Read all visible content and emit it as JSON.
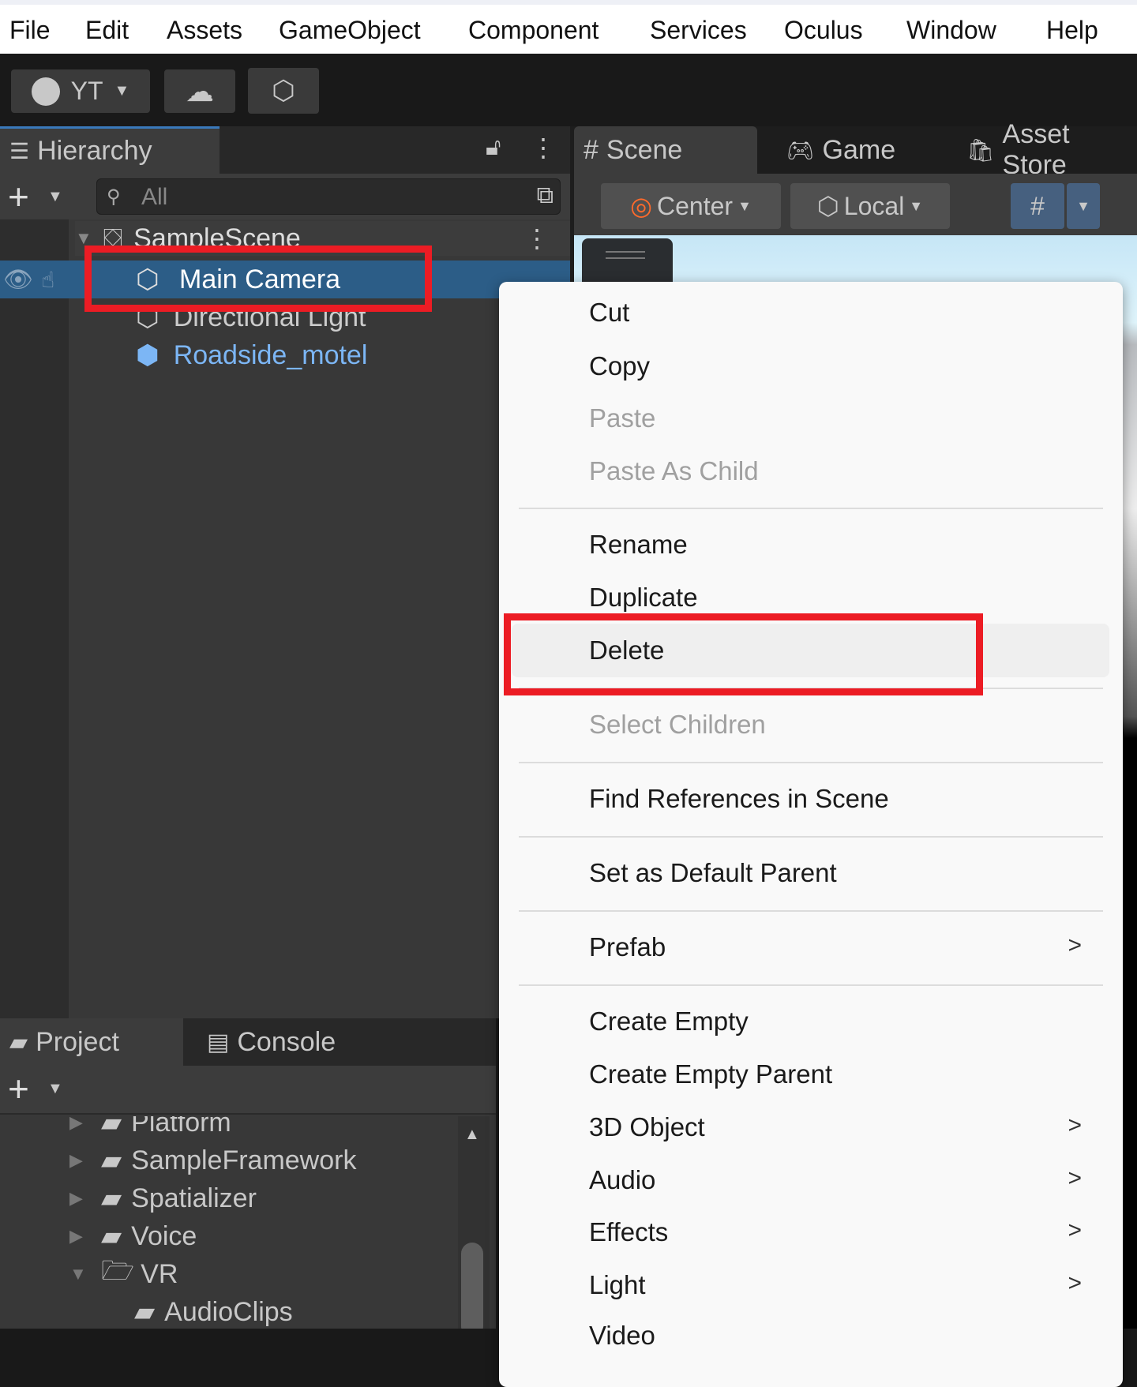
{
  "menubar": [
    "File",
    "Edit",
    "Assets",
    "GameObject",
    "Component",
    "Services",
    "Oculus",
    "Window",
    "Help"
  ],
  "toolbar": {
    "account": "YT"
  },
  "hierarchy": {
    "tab": "Hierarchy",
    "search_placeholder": "All",
    "scene": "SampleScene",
    "items": [
      "Main Camera",
      "Directional Light",
      "Roadside_motel"
    ]
  },
  "scene_panel": {
    "tabs": [
      "Scene",
      "Game",
      "Asset Store"
    ],
    "pivot": "Center",
    "space": "Local"
  },
  "project": {
    "tabs": [
      "Project",
      "Console"
    ],
    "folders": [
      "Platform",
      "SampleFramework",
      "Spatializer",
      "Voice",
      "VR",
      "AudioClips"
    ]
  },
  "context_menu": {
    "items": [
      {
        "label": "Cut"
      },
      {
        "label": "Copy"
      },
      {
        "label": "Paste",
        "disabled": true
      },
      {
        "label": "Paste As Child",
        "disabled": true
      },
      {
        "label": "Rename"
      },
      {
        "label": "Duplicate"
      },
      {
        "label": "Delete",
        "highlighted": true
      },
      {
        "label": "Select Children",
        "disabled": true
      },
      {
        "label": "Find References in Scene"
      },
      {
        "label": "Set as Default Parent"
      },
      {
        "label": "Prefab",
        "submenu": true
      },
      {
        "label": "Create Empty"
      },
      {
        "label": "Create Empty Parent"
      },
      {
        "label": "3D Object",
        "submenu": true
      },
      {
        "label": "Audio",
        "submenu": true
      },
      {
        "label": "Effects",
        "submenu": true
      },
      {
        "label": "Light",
        "submenu": true
      },
      {
        "label": "Video",
        "submenu": true
      }
    ]
  },
  "colors": {
    "selection": "#2c5d87",
    "highlight": "#ec1c24",
    "prefab": "#7cb6f5"
  }
}
